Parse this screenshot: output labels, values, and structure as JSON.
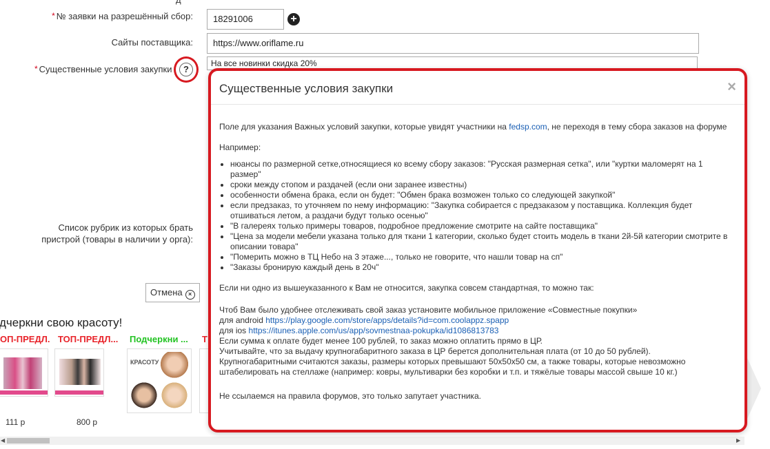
{
  "form": {
    "request_label": "№ заявки на разрешённый сбор:",
    "request_value": "18291006",
    "sites_label": "Сайты поставщика:",
    "sites_value": "https://www.oriflame.ru",
    "conditions_label": "Существенные условия закупки",
    "conditions_value": "На все новинки скидка 20%",
    "help_glyph": "?",
    "plus_glyph": "+",
    "required_mark": "*",
    "rubrics_label_line1": "Список рубрик из которых брать",
    "rubrics_label_line2": "пристрой (товары в наличии у орга):",
    "cancel_label": "Отмена",
    "cancel_icon_glyph": "×"
  },
  "gallery": {
    "title": "дчеркни свою красоту!",
    "items": [
      {
        "title": "ОП-ПРЕДЛ...",
        "color": "#e8232a",
        "price": "111 р"
      },
      {
        "title": "ТОП-ПРЕДЛ...",
        "color": "#e8232a",
        "price": "800 р"
      },
      {
        "title": "Подчеркни ...",
        "color": "#22c322",
        "price": ""
      },
      {
        "title": "Т",
        "color": "#e8232a",
        "price": ""
      }
    ],
    "thumb2_text": "",
    "thumb3_text": "КРАСОТУ"
  },
  "modal": {
    "title": "Существенные условия закупки",
    "close_glyph": "×",
    "intro_pre": "Поле для указания Важных условий закупки, которые увидят участники на ",
    "intro_link": "fedsp.com",
    "intro_post": ", не переходя в тему сбора заказов на форуме",
    "example_heading": "Например:",
    "bullets": [
      "нюансы по размерной сетке,относящиеся ко всему сбору заказов: \"Русская размерная сетка\", или \"куртки маломерят на 1 размер\"",
      "сроки между стопом и раздачей (если они заранее известны)",
      "особенности обмена брака, если он будет: \"Обмен брака возможен только со следующей закупкой\"",
      "если предзаказ, то уточняем по нему информацию: \"Закупка собирается с предзаказом у поставщика. Коллекция будет отшиваться летом, а раздачи будут только осенью\"",
      "\"В галереях только примеры товаров, подробное предложение смотрите на сайте поставщика\"",
      "\"Цена за модели мебели указана только для ткани 1 категории, сколько будет стоить модель в ткани 2й-5й категории смотрите в описании товара\"",
      "\"Померить можно в ТЦ Небо на 3 этаже..., только не говорите, что нашли товар на сп\"",
      "\"Заказы бронирую каждый день в 20ч\""
    ],
    "standard_text": "Если ни одно из вышеуказанного к Вам не относится, закупка совсем стандартная, то можно так:",
    "app_line": "Чтоб Вам было удобнее отслеживать свой заказ установите мобильное приложение «Совместные покупки»",
    "android_pre": "для android ",
    "android_link": "https://play.google.com/store/apps/details?id=com.coolappz.spapp",
    "ios_pre": "для ios ",
    "ios_link": "https://itunes.apple.com/us/app/sovmestnaa-pokupka/id1086813783",
    "line_sum": "Если сумма к оплате будет менее 100 рублей, то заказ можно оплатить прямо в ЦР.",
    "line_fee": "Учитывайте, что за выдачу крупногабаритного заказа в ЦР берется дополнительная плата (от 10 до 50 рублей).",
    "line_big": "Крупногабаритными считаются заказы, размеры которых превышают 50х50х50 см, а также товары, которые невозможно штабелировать на стеллаже (например: ковры, мультиварки без коробки и т.п. и тяжёлые товары массой свыше 10 кг.)",
    "footer_text": "Не ссылаемся на правила форумов, это только запутает участника."
  },
  "colors": {
    "highlight_red": "#d71920",
    "link_blue": "#1a5fb4"
  }
}
